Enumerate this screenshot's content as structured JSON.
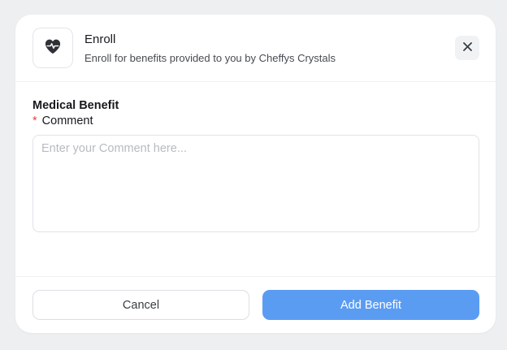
{
  "header": {
    "title": "Enroll",
    "subtitle": "Enroll for benefits provided to you by Cheffys Crystals",
    "icon": "heart-pulse-icon",
    "close_icon": "close-icon"
  },
  "form": {
    "section_title": "Medical Benefit",
    "required_marker": "*",
    "comment_label": "Comment",
    "comment_value": "",
    "comment_placeholder": "Enter your Comment here..."
  },
  "footer": {
    "cancel_label": "Cancel",
    "submit_label": "Add Benefit"
  },
  "colors": {
    "primary": "#5b9cf3",
    "required": "#e0463c",
    "backdrop": "#eeeff1"
  }
}
